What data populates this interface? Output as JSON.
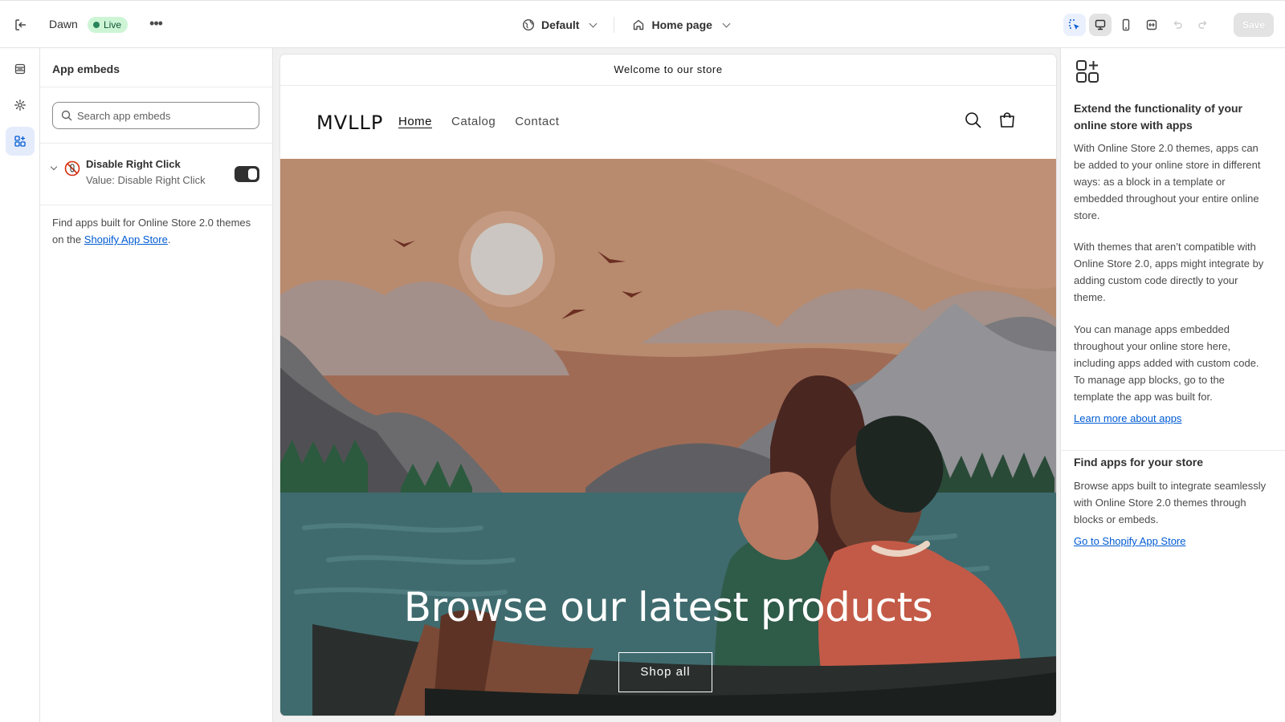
{
  "topbar": {
    "theme_name": "Dawn",
    "status_badge": "Live",
    "more": "•••",
    "view_dropdown": "Default",
    "page_dropdown": "Home page",
    "save_label": "Save"
  },
  "icons": {
    "exit": "exit-icon",
    "globe": "globe-icon",
    "home": "home-icon",
    "inspector": "inspector-icon",
    "desktop": "desktop-icon",
    "mobile": "mobile-icon",
    "fullscreen": "fullscreen-icon",
    "undo": "undo-icon",
    "redo": "redo-icon"
  },
  "rail": {
    "items": [
      {
        "name": "sections",
        "icon": "sections-icon"
      },
      {
        "name": "theme-settings",
        "icon": "gear-icon"
      },
      {
        "name": "app-embeds",
        "icon": "apps-icon",
        "active": true
      }
    ]
  },
  "left_panel": {
    "title": "App embeds",
    "search_placeholder": "Search app embeds",
    "embeds": [
      {
        "name": "Disable Right Click",
        "value": "Value: Disable Right Click",
        "enabled": true
      }
    ],
    "footer_text": "Find apps built for Online Store 2.0 themes on the",
    "footer_link": "Shopify App Store",
    "footer_end": "."
  },
  "preview": {
    "announcement": "Welcome to our store",
    "logo": "MVLLP",
    "nav": [
      "Home",
      "Catalog",
      "Contact"
    ],
    "hero_title": "Browse our latest products",
    "hero_button": "Shop all"
  },
  "right_panel": {
    "heading1": "Extend the functionality of your online store with apps",
    "para1": "With Online Store 2.0 themes, apps can be added to your online store in different ways: as a block in a template or embedded throughout your entire online store.",
    "para2": "With themes that aren’t compatible with Online Store 2.0, apps might integrate by adding custom code directly to your theme.",
    "para3": "You can manage apps embedded throughout your online store here, including apps added with custom code. To manage app blocks, go to the template the app was built for.",
    "link1": "Learn more about apps",
    "heading2": "Find apps for your store",
    "para4": "Browse apps built to integrate seamlessly with Online Store 2.0 themes through blocks or embeds.",
    "link2": "Go to Shopify App Store"
  },
  "colors": {
    "accent": "#005bd3",
    "live_badge_bg": "#cdf5d5",
    "hero_sky": "#b48468",
    "hero_water": "#3f6b6e"
  }
}
